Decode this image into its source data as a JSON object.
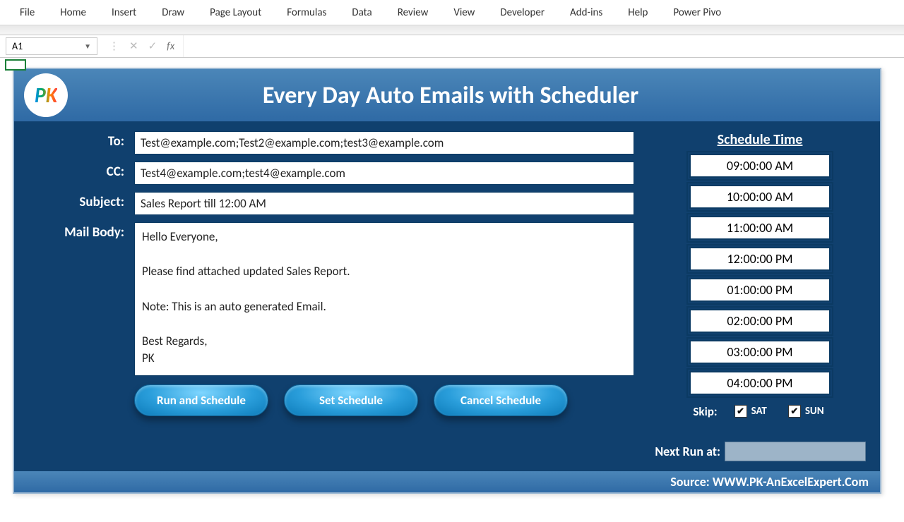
{
  "ribbon": {
    "tabs": [
      "File",
      "Home",
      "Insert",
      "Draw",
      "Page Layout",
      "Formulas",
      "Data",
      "Review",
      "View",
      "Developer",
      "Add-ins",
      "Help",
      "Power Pivo"
    ]
  },
  "formula_bar": {
    "name_box": "A1",
    "value": ""
  },
  "panel": {
    "title": "Every Day Auto Emails with Scheduler",
    "labels": {
      "to": "To:",
      "cc": "CC:",
      "subject": "Subject:",
      "body": "Mail Body:"
    },
    "to": "Test@example.com;Test2@example.com;test3@example.com",
    "cc": "Test4@example.com;test4@example.com",
    "subject": "Sales Report till 12:00 AM",
    "body": "Hello Everyone,\n\nPlease find attached updated Sales Report.\n\nNote: This is an auto generated Email.\n\nBest Regards,\nPK",
    "buttons": {
      "run": "Run and Schedule",
      "set": "Set Schedule",
      "cancel": "Cancel Schedule"
    },
    "schedule_title": "Schedule Time",
    "times": [
      "09:00:00 AM",
      "10:00:00 AM",
      "11:00:00 AM",
      "12:00:00 PM",
      "01:00:00 PM",
      "02:00:00 PM",
      "03:00:00 PM",
      "04:00:00 PM"
    ],
    "skip_label": "Skip:",
    "skip": {
      "sat_label": "SAT",
      "sat_checked": true,
      "sun_label": "SUN",
      "sun_checked": true
    },
    "next_run_label": "Next Run at:",
    "next_run_value": "",
    "footer": "Source: WWW.PK-AnExcelExpert.Com"
  }
}
